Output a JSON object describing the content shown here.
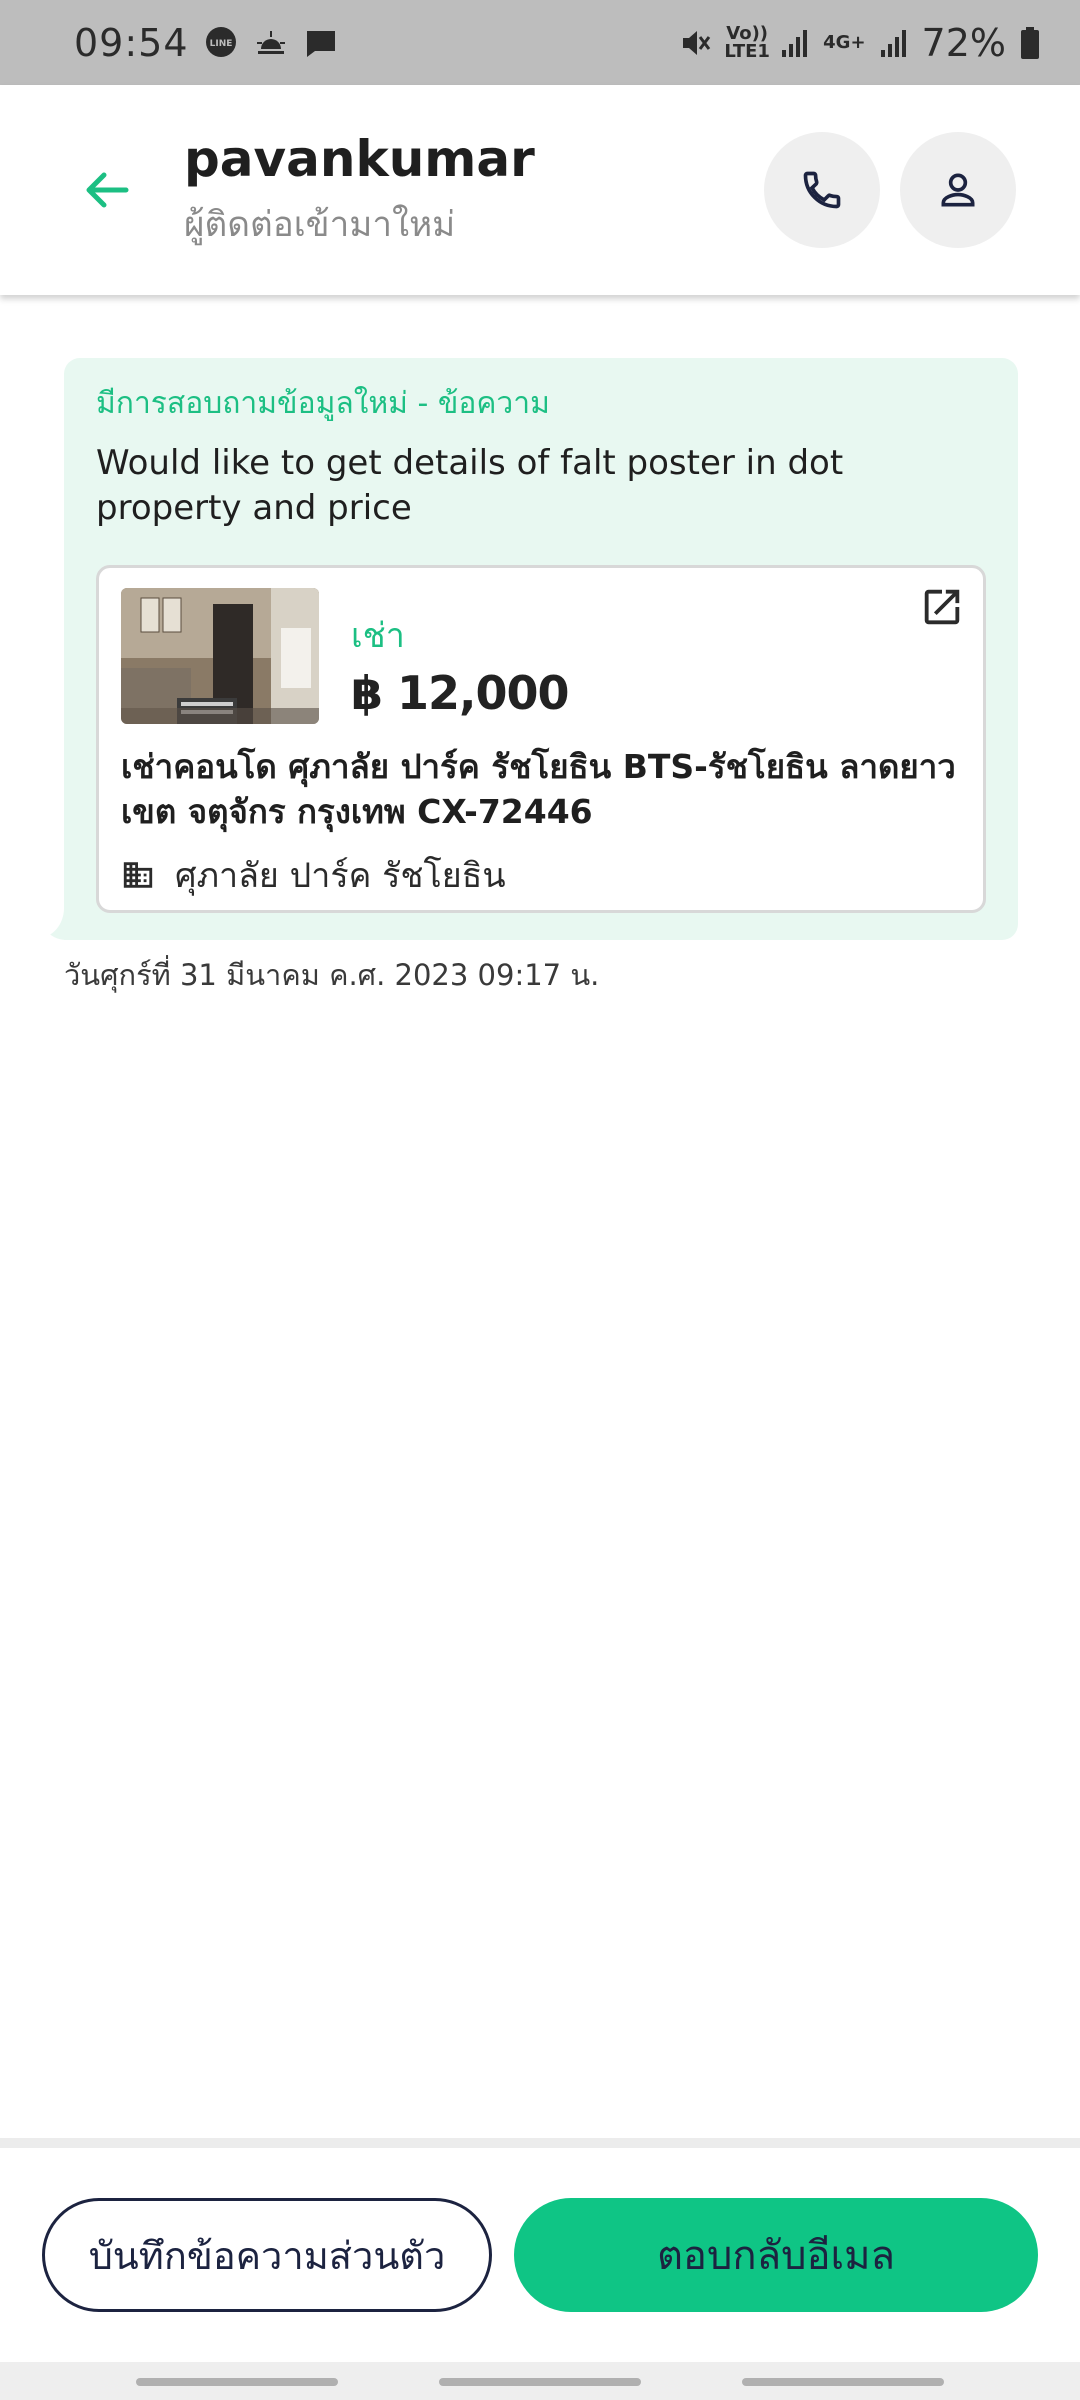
{
  "status_bar": {
    "time": "09:54",
    "signal_sim1_label": "Vo)) LTE1",
    "signal_sim2_label": "4G+",
    "battery": "72%"
  },
  "header": {
    "name": "pavankumar",
    "subtitle": "ผู้ติดต่อเข้ามาใหม่",
    "back_icon": "arrow-left-icon",
    "call_icon": "phone-icon",
    "profile_icon": "person-icon"
  },
  "message": {
    "label": "มีการสอบถามข้อมูลใหม่ - ข้อความ",
    "text": "Would like to get details of falt poster in dot property and price",
    "listing": {
      "type": "เช่า",
      "price": "฿ 12,000",
      "title": "เช่าคอนโด  ศุภาลัย ปาร์ค รัชโยธิน BTS-รัชโยธิน ลาดยาว เขต จตุจักร กรุงเทพ CX-72446",
      "building": "ศุภาลัย ปาร์ค รัชโยธิน",
      "open_icon": "open-external-icon",
      "building_icon": "building-icon"
    },
    "timestamp": "วันศุกร์ที่ 31 มีนาคม ค.ศ. 2023 09:17 น."
  },
  "actions": {
    "note_label": "บันทึกข้อความส่วนตัว",
    "reply_label": "ตอบกลับอีเมล"
  },
  "colors": {
    "accent": "#0fc585",
    "accent_text": "#1cbf83",
    "bubble_bg": "#e8f8f1",
    "dark_navy": "#1c2340",
    "status_bar_bg": "#bdbdbd"
  }
}
